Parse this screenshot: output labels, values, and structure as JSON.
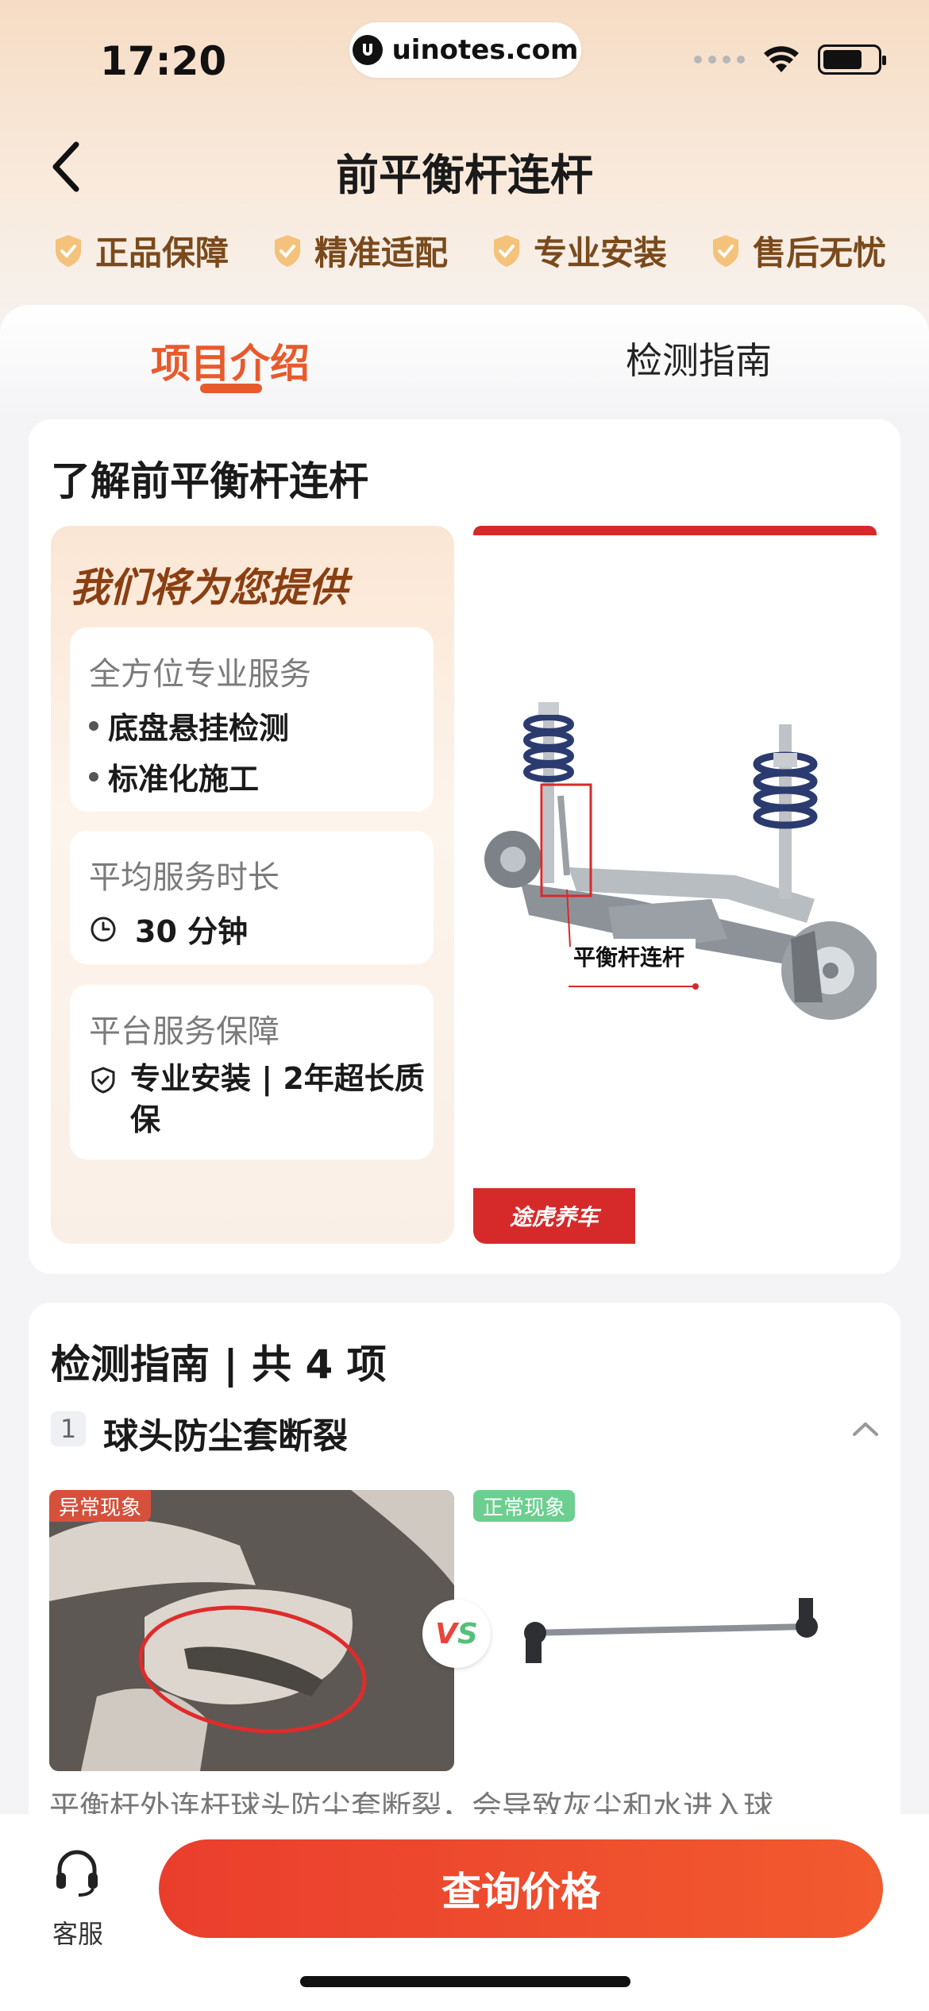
{
  "status_bar": {
    "time": "17:20",
    "url": "uinotes.com"
  },
  "header": {
    "title": "前平衡杆连杆",
    "guarantees": [
      "正品保障",
      "精准适配",
      "专业安装",
      "售后无忧"
    ]
  },
  "tabs": [
    {
      "label": "项目介绍",
      "active": true
    },
    {
      "label": "检测指南",
      "active": false
    }
  ],
  "intro": {
    "title": "了解前平衡杆连杆",
    "offer_heading": "我们将为您提供",
    "service": {
      "label": "全方位专业服务",
      "items": [
        "底盘悬挂检测",
        "标准化施工"
      ]
    },
    "duration": {
      "label": "平均服务时长",
      "value": "30 分钟"
    },
    "warranty": {
      "label": "平台服务保障",
      "value": "专业安装 | 2年超长质保"
    },
    "diagram": {
      "part_label": "平衡杆连杆",
      "brand": "途虎养车"
    }
  },
  "guide": {
    "title": "检测指南 | 共 4 项",
    "item": {
      "index": "1",
      "title": "球头防尘套断裂",
      "abnormal_tag": "异常现象",
      "normal_tag": "正常现象",
      "vs": {
        "v": "V",
        "s": "S"
      },
      "description": "平衡杆外连杆球头防尘套断裂，会导致灰尘和水进入球"
    }
  },
  "bottom": {
    "service_label": "客服",
    "query_button": "查询价格"
  },
  "colors": {
    "accent": "#e85a2c",
    "button": "#ea3e2d",
    "brand_red": "#d62a2a",
    "guarantee_text": "#7a4a1c"
  }
}
